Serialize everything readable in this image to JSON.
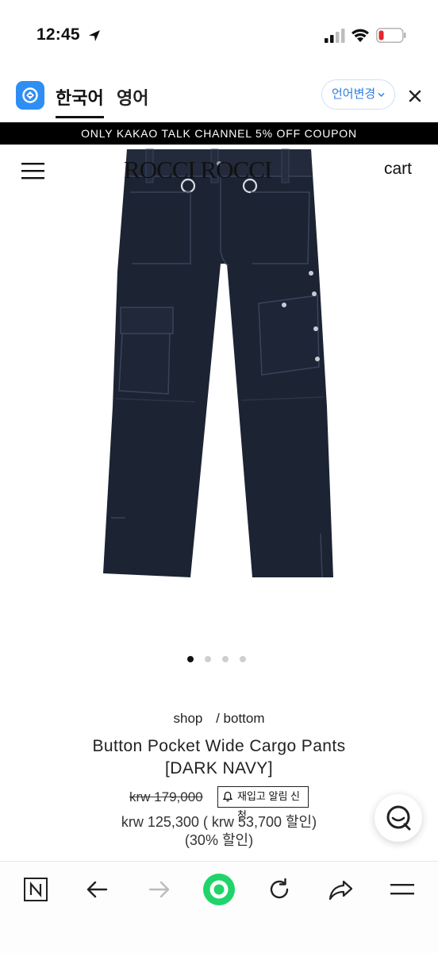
{
  "status_bar": {
    "time": "12:45",
    "icons": [
      "location-arrow-icon",
      "cellular-signal-icon",
      "wifi-icon",
      "battery-low-icon"
    ]
  },
  "translate_bar": {
    "lang_source": "한국어",
    "lang_target": "영어",
    "change_label": "언어변경",
    "accent_color": "#2f8ef3"
  },
  "promo_banner": {
    "text": "ONLY KAKAO TALK CHANNEL 5% OFF COUPON"
  },
  "header": {
    "logo": "ROCCI ROCCI",
    "cart_label": "cart"
  },
  "carousel": {
    "total": 4,
    "active_index": 0
  },
  "product": {
    "breadcrumb_shop": "shop",
    "breadcrumb_category": "/ bottom",
    "title_line1": "Button Pocket Wide Cargo Pants",
    "title_line2": "[DARK NAVY]",
    "original_price": "krw 179,000",
    "restock_label": "재입고 알림 신청",
    "sale_price_line": "krw 125,300 ( krw 53,700 할인)",
    "discount_pct_line": "(30% 할인)",
    "product_color": "#1c2333"
  },
  "bottom_toolbar": {
    "icons": [
      "naver-home-icon",
      "back-arrow-icon",
      "forward-arrow-icon",
      "green-home-circle-icon",
      "reload-icon",
      "share-icon",
      "menu-icon"
    ]
  }
}
